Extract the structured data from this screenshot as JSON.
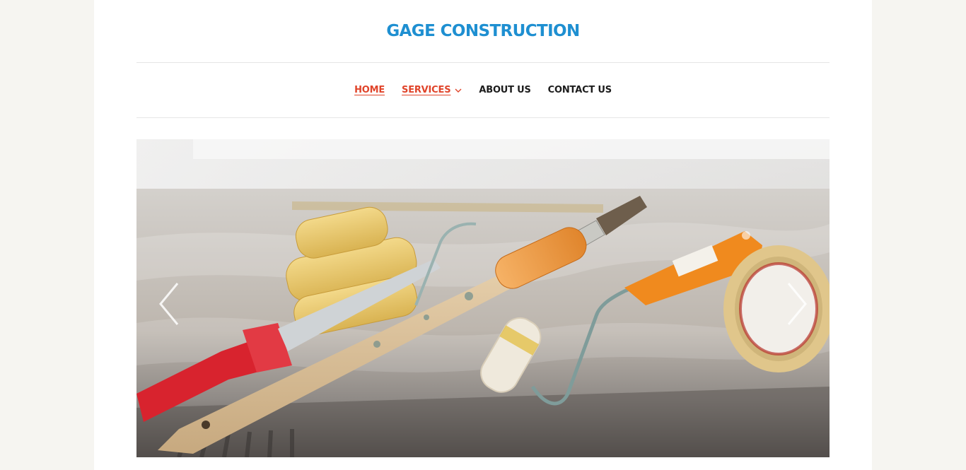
{
  "site": {
    "title": "GAGE CONSTRUCTION"
  },
  "nav": {
    "items": [
      {
        "label": "HOME",
        "active": true,
        "has_submenu": false
      },
      {
        "label": "SERVICES",
        "active": true,
        "has_submenu": true
      },
      {
        "label": "ABOUT US",
        "active": false,
        "has_submenu": false
      },
      {
        "label": "CONTACT US",
        "active": false,
        "has_submenu": false
      }
    ]
  },
  "slider": {
    "image_subject": "painting tools: foam rollers, paint brush, roller frame, masking tape on a plastic-covered window sill",
    "prev_icon": "chevron-left-icon",
    "next_icon": "chevron-right-icon"
  },
  "colors": {
    "page_background": "#f6f5f1",
    "content_background": "#ffffff",
    "title": "#1e8fd1",
    "nav_active": "#e0442a",
    "nav_text": "#1c1c1c"
  }
}
